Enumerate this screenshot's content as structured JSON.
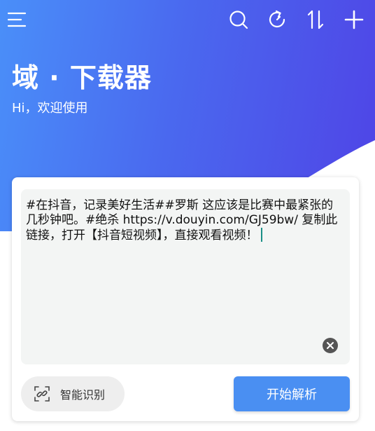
{
  "header": {
    "title": "域 · 下载器",
    "subtitle": "Hi，欢迎使用",
    "icons": [
      "menu-icon",
      "search-icon",
      "refresh-icon",
      "sort-icon",
      "add-icon"
    ]
  },
  "input": {
    "value": "#在抖音，记录美好生活##罗斯 这应该是比赛中最紧张的几秒钟吧。#绝杀 https://v.douyin.com/GJ59bw/ 复制此链接，打开【抖音短视频】，直接观看视频！"
  },
  "actions": {
    "smart_label": "智能识别",
    "start_label": "开始解析"
  },
  "colors": {
    "accent": "#4a8ff2",
    "gradient_start": "#4a8ff9",
    "gradient_end": "#4f44e6",
    "caret": "#1a8f86"
  }
}
